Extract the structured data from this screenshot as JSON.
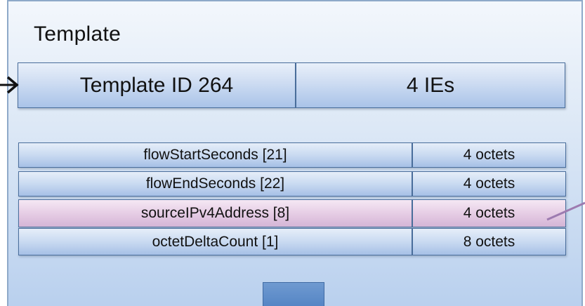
{
  "template": {
    "title": "Template",
    "id_label": "Template ID 264",
    "ie_count_label": "4 IEs"
  },
  "fields": [
    {
      "name": "flowStartSeconds [21]",
      "size": "4 octets",
      "highlighted": false
    },
    {
      "name": "flowEndSeconds [22]",
      "size": "4 octets",
      "highlighted": false
    },
    {
      "name": "sourceIPv4Address [8]",
      "size": "4 octets",
      "highlighted": true
    },
    {
      "name": "octetDeltaCount [1]",
      "size": "8 octets",
      "highlighted": false
    }
  ],
  "colors": {
    "panel_border": "#8ea9c9",
    "cell_border": "#4a6e9c",
    "row_blue": "#c9daf1",
    "row_highlight": "#e6cde5",
    "connector_purple": "#9d7bb0",
    "arrow_black": "#111111"
  }
}
